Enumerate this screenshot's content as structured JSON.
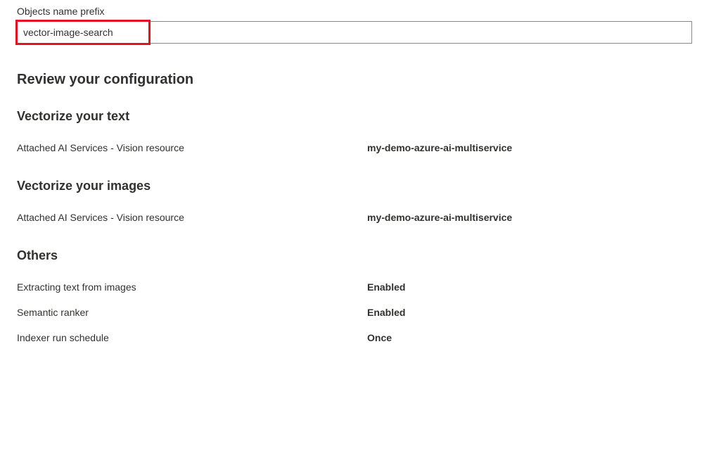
{
  "prefix": {
    "label": "Objects name prefix",
    "value": "vector-image-search"
  },
  "review": {
    "heading": "Review your configuration",
    "sections": [
      {
        "heading": "Vectorize your text",
        "rows": [
          {
            "label": "Attached AI Services - Vision resource",
            "value": "my-demo-azure-ai-multiservice"
          }
        ]
      },
      {
        "heading": "Vectorize your images",
        "rows": [
          {
            "label": "Attached AI Services - Vision resource",
            "value": "my-demo-azure-ai-multiservice"
          }
        ]
      },
      {
        "heading": "Others",
        "rows": [
          {
            "label": "Extracting text from images",
            "value": "Enabled"
          },
          {
            "label": "Semantic ranker",
            "value": "Enabled"
          },
          {
            "label": "Indexer run schedule",
            "value": "Once"
          }
        ]
      }
    ]
  }
}
